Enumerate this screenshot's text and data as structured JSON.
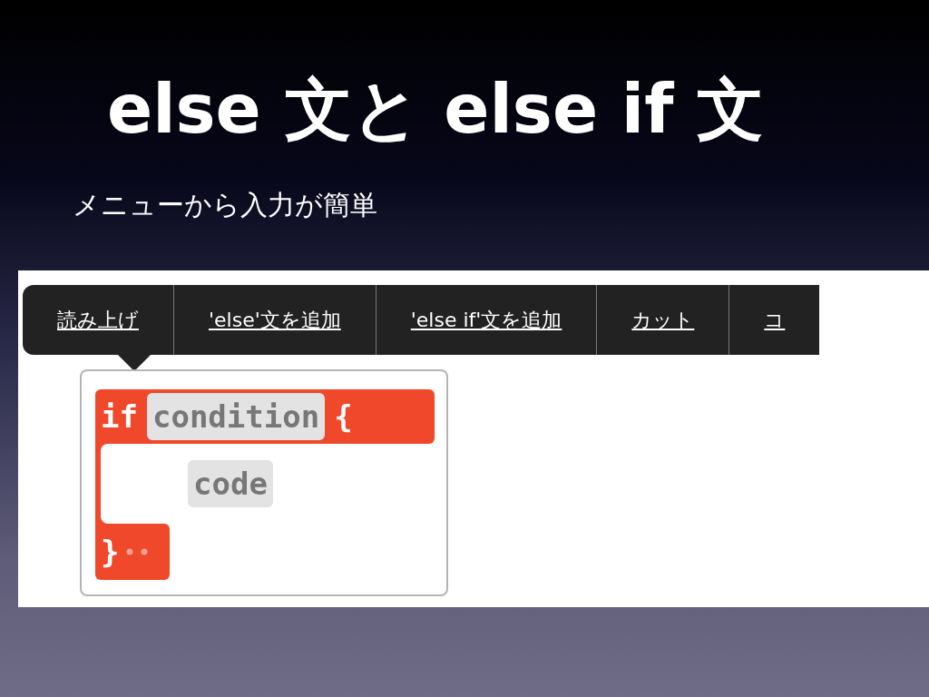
{
  "slide": {
    "title": "else 文と else if 文",
    "subtitle": "メニューから入力が簡単"
  },
  "menu": {
    "items": [
      {
        "label": "読み上げ"
      },
      {
        "label": "'else'文を追加"
      },
      {
        "label": "'else if'文を追加"
      },
      {
        "label": "カット"
      },
      {
        "label": "コ"
      }
    ]
  },
  "code_block": {
    "keyword": "if",
    "condition": "condition",
    "open_brace": "{",
    "body": "code",
    "close_brace": "}"
  }
}
